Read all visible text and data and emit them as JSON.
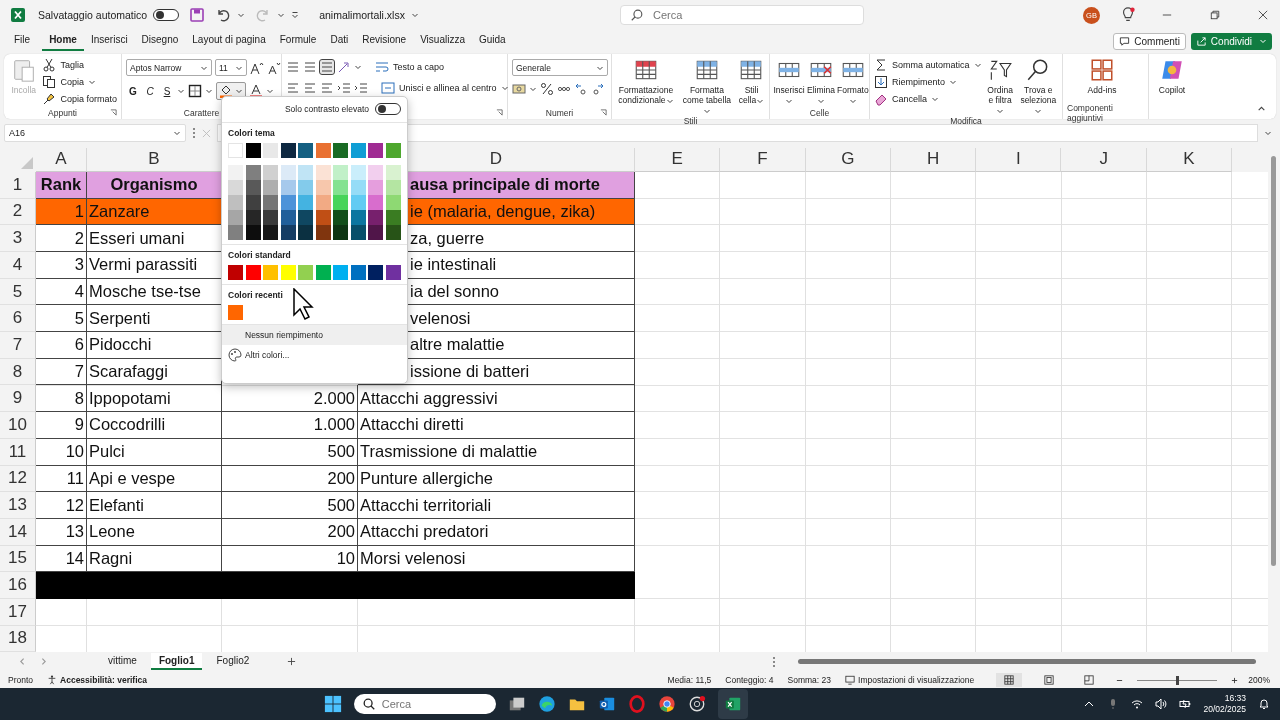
{
  "title_bar": {
    "autosave": {
      "label": "Salvataggio automatico",
      "on": false
    },
    "filename": "animalimortali.xlsx",
    "search": {
      "placeholder": "Cerca"
    },
    "avatar": "GB"
  },
  "menu_tabs": [
    {
      "label": "File",
      "selected": false
    },
    {
      "label": "Home",
      "selected": true
    },
    {
      "label": "Inserisci",
      "selected": false
    },
    {
      "label": "Disegno",
      "selected": false
    },
    {
      "label": "Layout di pagina",
      "selected": false
    },
    {
      "label": "Formule",
      "selected": false
    },
    {
      "label": "Dati",
      "selected": false
    },
    {
      "label": "Revisione",
      "selected": false
    },
    {
      "label": "Visualizza",
      "selected": false
    },
    {
      "label": "Guida",
      "selected": false
    }
  ],
  "comments_button": "Commenti",
  "share_button": "Condividi",
  "ribbon": {
    "clipboard": {
      "label": "Appunti",
      "paste": {
        "label": "Incolla",
        "disabled": true
      },
      "items": [
        "Taglia",
        "Copia",
        "Copia formato"
      ]
    },
    "font": {
      "label": "Carattere",
      "font_name": "Aptos Narrow",
      "font_size": "11",
      "bold": "G",
      "italic": "C",
      "underline": "S"
    },
    "alignment": {
      "wrap": "Testo a capo",
      "merge": "Unisci e allinea al centro"
    },
    "number": {
      "label": "Numeri",
      "format": "Generale"
    },
    "styles": {
      "label": "Stili",
      "items": [
        "Formattazione condizionale",
        "Formatta come tabella",
        "Stili cella"
      ]
    },
    "cells": {
      "label": "Celle",
      "items": [
        "Inserisci",
        "Elimina",
        "Formato"
      ]
    },
    "editing": {
      "label": "Modifica",
      "items": [
        "Somma automatica",
        "Riempimento",
        "Cancella"
      ],
      "sort": "Ordina e filtra",
      "find": "Trova e seleziona"
    },
    "addins": {
      "label": "Componenti aggiuntivi",
      "button": "Add-ins"
    },
    "copilot": "Copilot"
  },
  "formula_bar": {
    "name_box": "A16"
  },
  "sheet": {
    "columns": [
      {
        "label": "A"
      },
      {
        "label": "B"
      },
      {},
      {
        "label": "D"
      },
      {
        "label": "E"
      },
      {
        "label": "F"
      },
      {
        "label": "G"
      },
      {
        "label": "H"
      },
      {
        "label": "I"
      },
      {
        "label": "J"
      },
      {
        "label": "K"
      }
    ],
    "rows": [
      {
        "number": "1",
        "kind": "header",
        "color": "#e0a0e0",
        "cells": [
          "Rank",
          "Organismo",
          null,
          "ausa principale di morte"
        ]
      },
      {
        "number": "2",
        "kind": "data",
        "color": "#ff6600",
        "cells": [
          "1",
          "Zanzare",
          null,
          "ie (malaria, dengue, zika)"
        ]
      },
      {
        "number": "3",
        "kind": "data",
        "cells": [
          "2",
          "Esseri umani",
          null,
          "za, guerre"
        ]
      },
      {
        "number": "4",
        "kind": "data",
        "cells": [
          "3",
          "Vermi parassiti",
          null,
          "ie intestinali"
        ]
      },
      {
        "number": "5",
        "kind": "data",
        "cells": [
          "4",
          "Mosche tse-tse",
          null,
          "ia del sonno"
        ]
      },
      {
        "number": "6",
        "kind": "data",
        "cells": [
          "5",
          "Serpenti",
          null,
          "velenosi"
        ]
      },
      {
        "number": "7",
        "kind": "data",
        "cells": [
          "6",
          "Pidocchi",
          null,
          "altre malattie"
        ]
      },
      {
        "number": "8",
        "kind": "data",
        "cells": [
          "7",
          "Scarafaggi",
          null,
          "issione di batteri"
        ]
      },
      {
        "number": "9",
        "kind": "data",
        "cells": [
          "8",
          "Ippopotami",
          "2.000",
          "Attacchi aggressivi"
        ]
      },
      {
        "number": "10",
        "kind": "data",
        "cells": [
          "9",
          "Coccodrilli",
          "1.000",
          "Attacchi diretti"
        ]
      },
      {
        "number": "11",
        "kind": "data",
        "cells": [
          "10",
          "Pulci",
          "500",
          "Trasmissione di malattie"
        ]
      },
      {
        "number": "12",
        "kind": "data",
        "cells": [
          "11",
          "Api e vespe",
          "200",
          "Punture allergiche"
        ]
      },
      {
        "number": "13",
        "kind": "data",
        "cells": [
          "12",
          "Elefanti",
          "500",
          "Attacchi territoriali"
        ]
      },
      {
        "number": "14",
        "kind": "data",
        "cells": [
          "13",
          "Leone",
          "200",
          "Attacchi predatori"
        ]
      },
      {
        "number": "15",
        "kind": "data",
        "cells": [
          "14",
          "Ragni",
          "10",
          "Morsi velenosi"
        ]
      },
      {
        "number": "16",
        "color": "#000000"
      },
      {
        "number": "17"
      },
      {
        "number": "18"
      }
    ]
  },
  "color_menu": {
    "high_contrast": {
      "label": "Solo contrasto elevato",
      "on": false
    },
    "theme_title": "Colori tema",
    "theme": [
      {
        "color": "#ffffff",
        "shades": [
          {
            "color": "#f2f2f2"
          },
          {
            "color": "#d9d9d9"
          },
          {
            "color": "#bfbfbf"
          },
          {
            "color": "#a6a6a6"
          },
          {
            "color": "#808080"
          }
        ]
      },
      {
        "color": "#000000",
        "shades": [
          {
            "color": "#7f7f7f"
          },
          {
            "color": "#595959"
          },
          {
            "color": "#404040"
          },
          {
            "color": "#262626"
          },
          {
            "color": "#0d0d0d"
          }
        ]
      },
      {
        "color": "#e8e8e8",
        "shades": [
          {
            "color": "#d0d0d0"
          },
          {
            "color": "#aeaeae"
          },
          {
            "color": "#757575"
          },
          {
            "color": "#3a3a3a"
          },
          {
            "color": "#171717"
          }
        ]
      },
      {
        "color": "#0e2841",
        "shades": [
          {
            "color": "#dceaf7"
          },
          {
            "color": "#a6c9ec"
          },
          {
            "color": "#4d93d9"
          },
          {
            "color": "#215f9a"
          },
          {
            "color": "#153d64"
          }
        ]
      },
      {
        "color": "#156082",
        "shades": [
          {
            "color": "#c0e4f5"
          },
          {
            "color": "#83cbeb"
          },
          {
            "color": "#44b3e1"
          },
          {
            "color": "#0f4761"
          },
          {
            "color": "#0b3041"
          }
        ]
      },
      {
        "color": "#e97132",
        "shades": [
          {
            "color": "#fbe2d5"
          },
          {
            "color": "#f7c7ac"
          },
          {
            "color": "#f2aa84"
          },
          {
            "color": "#c04f15"
          },
          {
            "color": "#80350e"
          }
        ]
      },
      {
        "color": "#196b24",
        "shades": [
          {
            "color": "#c1f0c8"
          },
          {
            "color": "#84e291"
          },
          {
            "color": "#47d45a"
          },
          {
            "color": "#124f1a"
          },
          {
            "color": "#0d3512"
          }
        ]
      },
      {
        "color": "#0f9ed5",
        "shades": [
          {
            "color": "#caeefb"
          },
          {
            "color": "#95dcf7"
          },
          {
            "color": "#61cbf3"
          },
          {
            "color": "#0b76a0"
          },
          {
            "color": "#074f6a"
          }
        ]
      },
      {
        "color": "#a02b93",
        "shades": [
          {
            "color": "#f2cfee"
          },
          {
            "color": "#e59edd"
          },
          {
            "color": "#d86dcd"
          },
          {
            "color": "#77206d"
          },
          {
            "color": "#501549"
          }
        ]
      },
      {
        "color": "#4ea72e",
        "shades": [
          {
            "color": "#d9f2d0"
          },
          {
            "color": "#b4e5a2"
          },
          {
            "color": "#8ed973"
          },
          {
            "color": "#3a7c22"
          },
          {
            "color": "#275317"
          }
        ]
      }
    ],
    "standard_title": "Colori standard",
    "standard": [
      {
        "color": "#c00000"
      },
      {
        "color": "#ff0000"
      },
      {
        "color": "#ffc000"
      },
      {
        "color": "#ffff00"
      },
      {
        "color": "#92d050"
      },
      {
        "color": "#00b050"
      },
      {
        "color": "#00b0f0"
      },
      {
        "color": "#0070c0"
      },
      {
        "color": "#002060"
      },
      {
        "color": "#7030a0"
      }
    ],
    "recent_title": "Colori recenti",
    "recent": [
      {
        "color": "#ff6600"
      }
    ],
    "no_fill": "Nessun riempimento",
    "more": "Altri colori..."
  },
  "sheet_tabs": [
    {
      "label": "vittime",
      "selected": false
    },
    {
      "label": "Foglio1",
      "selected": true
    },
    {
      "label": "Foglio2",
      "selected": false
    }
  ],
  "status_bar": {
    "ready": "Pronto",
    "accessibility": "Accessibilità: verifica",
    "stats": [
      "Media: 11,5",
      "Conteggio: 4",
      "Somma: 23"
    ],
    "view_settings": "Impostazioni di visualizzazione",
    "views": [
      {
        "selected": true
      },
      {
        "selected": false
      },
      {
        "selected": false
      }
    ],
    "zoom": {
      "level": 0.5,
      "reading": "200%"
    }
  },
  "taskbar": {
    "search": {
      "placeholder": "Cerca"
    },
    "time": "16:33",
    "date": "20/02/2025"
  }
}
